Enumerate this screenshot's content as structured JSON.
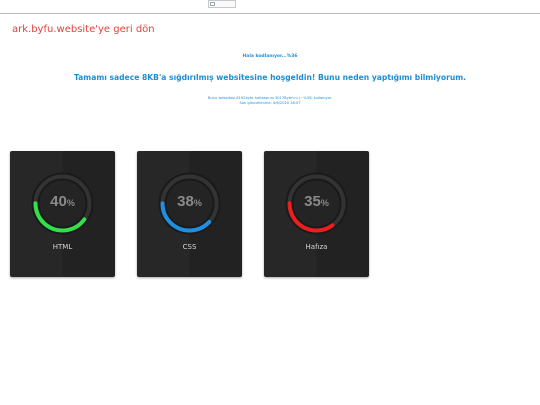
{
  "back_link": "ark.byfu.website'ye geri dön",
  "status_line": "Hala kodlanıyor...%36",
  "headline": "Tamamı sadece 8KB'a sığdırılmış websitesine hoşgeldin! Bunu neden yaptığımı bilmiyorum.",
  "info_line1": "Bunu websitesi 8192byte hafızasının 3017Byte'ını (~%35) kullanıyor.",
  "info_line2": "Son güncellenme: 4/6/2020 18:07",
  "cards": [
    {
      "label": "HTML",
      "percent": 40,
      "percent_text": "40",
      "unit": "%",
      "color": "#31e14a"
    },
    {
      "label": "CSS",
      "percent": 38,
      "percent_text": "38",
      "unit": "%",
      "color": "#1e8fe1"
    },
    {
      "label": "Hafıza",
      "percent": 35,
      "percent_text": "35",
      "unit": "%",
      "color": "#ef1d1d"
    }
  ]
}
